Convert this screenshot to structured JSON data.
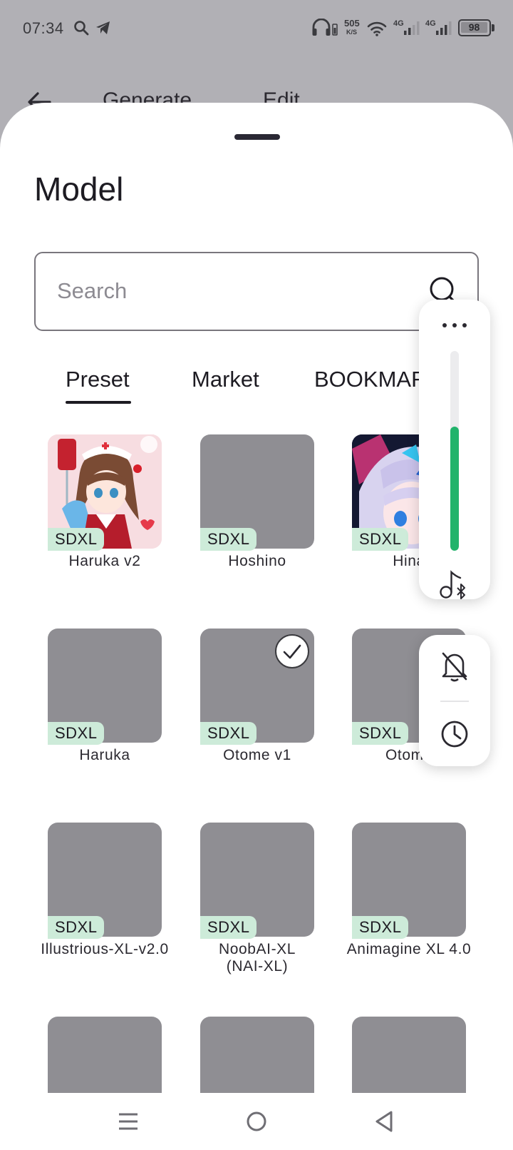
{
  "status_bar": {
    "time": "07:34",
    "net_speed_value": "505",
    "net_speed_unit": "K/S",
    "signal1_label": "4G",
    "signal2_label": "4G",
    "battery": "98",
    "icons": [
      "search-icon",
      "telegram-icon",
      "headphones-icon",
      "wifi-icon",
      "signal-icon",
      "battery-icon"
    ]
  },
  "background_header": {
    "back_icon": "arrow-left-icon",
    "tabs": [
      "Generate",
      "Edit"
    ]
  },
  "sheet": {
    "title": "Model",
    "search": {
      "placeholder": "Search",
      "value": ""
    },
    "tabs": [
      {
        "label": "Preset",
        "active": true
      },
      {
        "label": "Market",
        "active": false
      },
      {
        "label": "BOOKMAR",
        "active": false
      }
    ],
    "models": [
      {
        "name": "Haruka v2",
        "badge": "SDXL",
        "image": "anime-nurse-illustration",
        "selected": false
      },
      {
        "name": "Hoshino",
        "badge": "SDXL",
        "image": "placeholder",
        "selected": false
      },
      {
        "name": "Hina",
        "badge": "SDXL",
        "image": "anime-girl-blue-hair-illustration",
        "selected": false
      },
      {
        "name": "Haruka",
        "badge": "SDXL",
        "image": "placeholder",
        "selected": false
      },
      {
        "name": "Otome v1",
        "badge": "SDXL",
        "image": "placeholder",
        "selected": true
      },
      {
        "name": "Otome",
        "badge": "SDXL",
        "image": "placeholder",
        "selected": false
      },
      {
        "name": "Illustrious-XL-v2.0",
        "badge": "SDXL",
        "image": "placeholder",
        "selected": false
      },
      {
        "name": "NoobAI-XL (NAI-XL)",
        "badge": "SDXL",
        "image": "placeholder",
        "selected": false
      },
      {
        "name": "Animagine XL 4.0",
        "badge": "SDXL",
        "image": "placeholder",
        "selected": false
      },
      {
        "name": "",
        "badge": "",
        "image": "placeholder",
        "selected": false
      },
      {
        "name": "",
        "badge": "",
        "image": "placeholder",
        "selected": false
      },
      {
        "name": "",
        "badge": "",
        "image": "placeholder",
        "selected": false
      }
    ]
  },
  "volume_panel": {
    "more_icon": "more-horizontal-icon",
    "level": 0.62,
    "accent": "#21b36b",
    "output_icon": "music-bluetooth-icon"
  },
  "notification_panel": {
    "icons": [
      "bell-off-icon",
      "clock-icon"
    ]
  },
  "nav_bar": {
    "icons": [
      "menu-icon",
      "home-icon",
      "back-icon"
    ]
  },
  "colors": {
    "scrim": "#b1b0b5",
    "thumbnail": "#8f8e93",
    "badge": "#cdebd9",
    "text": "#1d1b22"
  }
}
